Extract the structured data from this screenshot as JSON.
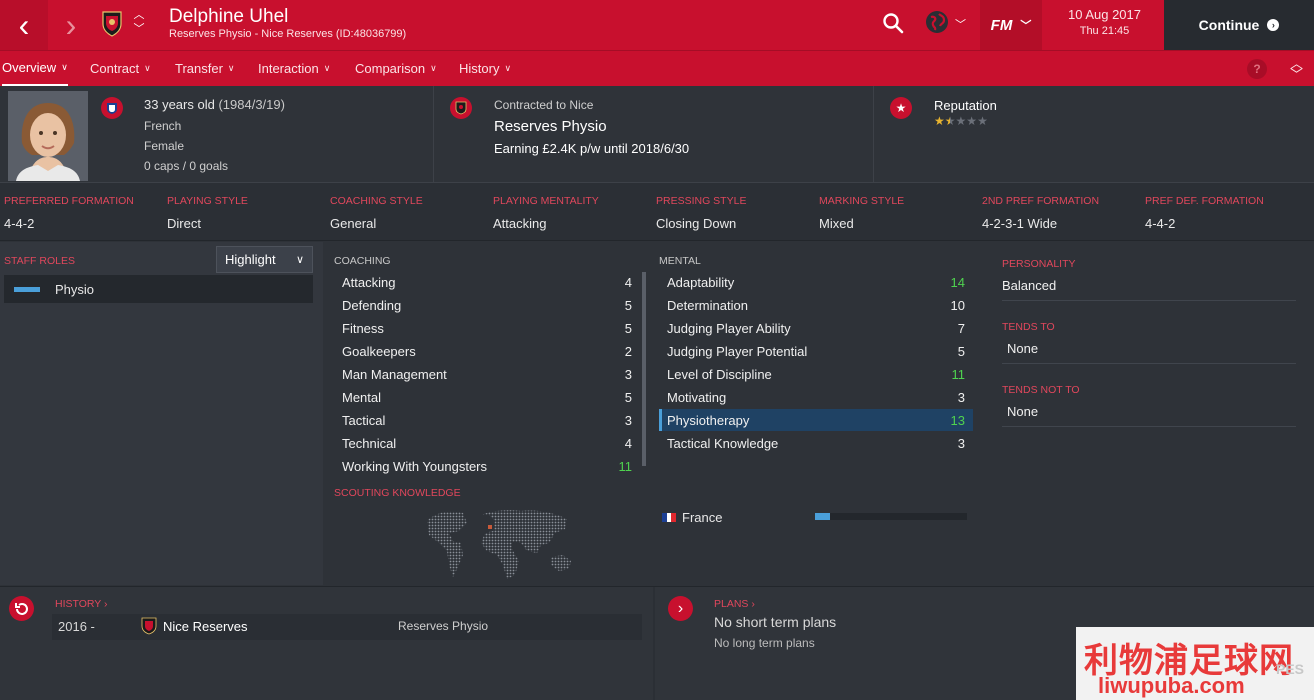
{
  "header": {
    "name": "Delphine Uhel",
    "subtitle": "Reserves Physio - Nice Reserves (ID:48036799)",
    "date": "10 Aug 2017",
    "time": "Thu 21:45",
    "fm_label": "FM",
    "continue_label": "Continue",
    "icons": [
      "back-icon",
      "forward-icon",
      "club-crest-icon",
      "up-down-arrows-icon",
      "search-icon",
      "globe-icon",
      "chevron-down-icon",
      "continue-arrow-icon"
    ]
  },
  "tabs": [
    {
      "label": "Overview"
    },
    {
      "label": "Contract"
    },
    {
      "label": "Transfer"
    },
    {
      "label": "Interaction"
    },
    {
      "label": "Comparison"
    },
    {
      "label": "History"
    }
  ],
  "help_label": "?",
  "info": {
    "age": "33 years old",
    "dob": "(1984/3/19)",
    "nationality": "French",
    "gender": "Female",
    "caps": "0 caps / 0 goals",
    "contract_head": "Contracted to Nice",
    "contract_role": "Reserves Physio",
    "contract_wage": "Earning £2.4K p/w until 2018/6/30",
    "reputation_label": "Reputation",
    "reputation_stars": 1.5,
    "reputation_max": 5
  },
  "styles": [
    {
      "label": "PREFERRED FORMATION",
      "value": "4-4-2"
    },
    {
      "label": "PLAYING STYLE",
      "value": "Direct"
    },
    {
      "label": "COACHING STYLE",
      "value": "General"
    },
    {
      "label": "PLAYING MENTALITY",
      "value": "Attacking"
    },
    {
      "label": "PRESSING STYLE",
      "value": "Closing Down"
    },
    {
      "label": "MARKING STYLE",
      "value": "Mixed"
    },
    {
      "label": "2ND PREF FORMATION",
      "value": "4-2-3-1 Wide"
    },
    {
      "label": "PREF DEF. FORMATION",
      "value": "4-4-2"
    }
  ],
  "staff_roles": {
    "label": "STAFF ROLES",
    "highlight_label": "Highlight",
    "roles": [
      "Physio"
    ]
  },
  "coaching": {
    "label": "COACHING",
    "items": [
      {
        "name": "Attacking",
        "value": "4"
      },
      {
        "name": "Defending",
        "value": "5"
      },
      {
        "name": "Fitness",
        "value": "5"
      },
      {
        "name": "Goalkeepers",
        "value": "2"
      },
      {
        "name": "Man Management",
        "value": "3"
      },
      {
        "name": "Mental",
        "value": "5"
      },
      {
        "name": "Tactical",
        "value": "3"
      },
      {
        "name": "Technical",
        "value": "4"
      },
      {
        "name": "Working With Youngsters",
        "value": "11"
      }
    ]
  },
  "mental": {
    "label": "MENTAL",
    "items": [
      {
        "name": "Adaptability",
        "value": "14"
      },
      {
        "name": "Determination",
        "value": "10"
      },
      {
        "name": "Judging Player Ability",
        "value": "7"
      },
      {
        "name": "Judging Player Potential",
        "value": "5"
      },
      {
        "name": "Level of Discipline",
        "value": "11"
      },
      {
        "name": "Motivating",
        "value": "3"
      },
      {
        "name": "Physiotherapy",
        "value": "13"
      },
      {
        "name": "Tactical Knowledge",
        "value": "3"
      }
    ]
  },
  "personality": {
    "label": "PERSONALITY",
    "value": "Balanced",
    "tends_to_label": "TENDS TO",
    "tends_to": "None",
    "tends_not_to_label": "TENDS NOT TO",
    "tends_not_to": "None"
  },
  "scouting": {
    "label": "SCOUTING KNOWLEDGE",
    "country": "France",
    "knowledge_fraction": 0.1
  },
  "history": {
    "label": "HISTORY",
    "rows": [
      {
        "years": "2016 -",
        "club": "Nice Reserves",
        "role": "Reserves Physio"
      }
    ]
  },
  "plans": {
    "label": "PLANS",
    "short": "No short term plans",
    "long": "No long term plans"
  },
  "watermark": {
    "cn": "利物浦足球网",
    "url": "liwupuba.com",
    "tag": "PES"
  },
  "colors": {
    "brand_red": "#c8102e",
    "accent_blue": "#4a9fd9",
    "good_green": "#4fd24f",
    "label_red": "#e0475c"
  }
}
